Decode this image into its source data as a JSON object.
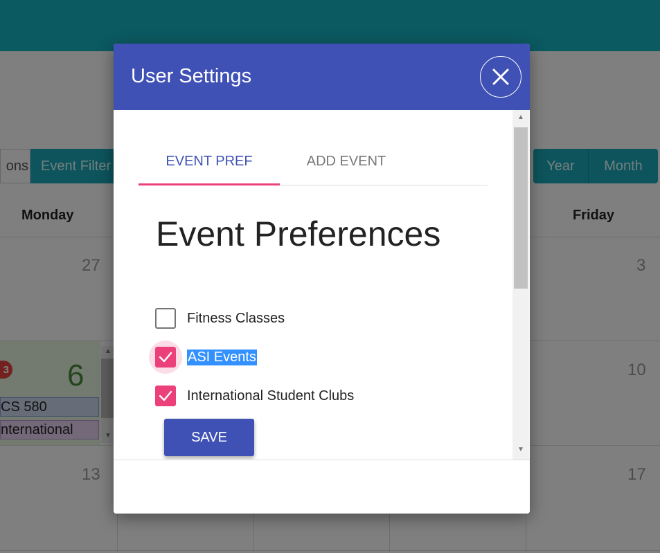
{
  "background": {
    "toolbar_left": [
      "ons",
      "Event Filter"
    ],
    "toolbar_right": [
      "Year",
      "Month"
    ],
    "weekdays": {
      "monday": "Monday",
      "friday": "Friday"
    },
    "days": {
      "d27": "27",
      "d3": "3",
      "d6": "6",
      "d10": "10",
      "d13": "13",
      "d17": "17"
    },
    "badge_count": "3",
    "events": [
      "CS 580",
      "nternational"
    ]
  },
  "modal": {
    "title": "User Settings",
    "tabs": [
      {
        "label": "EVENT PREF",
        "active": true
      },
      {
        "label": "ADD EVENT",
        "active": false
      }
    ],
    "section_title": "Event Preferences",
    "preferences": [
      {
        "label": "Fitness Classes",
        "checked": false
      },
      {
        "label": "ASI Events",
        "checked": true
      },
      {
        "label": "International Student Clubs",
        "checked": true
      }
    ],
    "save_label": "SAVE"
  },
  "colors": {
    "primary": "#3f51b5",
    "accent": "#ec407a",
    "topbar": "#17b4c2"
  },
  "icons": {
    "close": "close-icon",
    "check": "check-icon"
  }
}
